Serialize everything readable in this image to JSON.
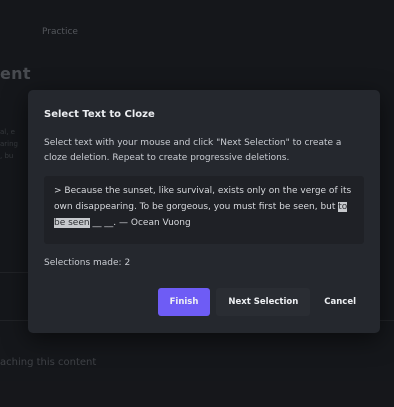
{
  "background": {
    "breadcrumb": "Practice",
    "title_fragment": "ent",
    "snippet_lines": [
      "al, e",
      "aring",
      ", bu"
    ],
    "footer_text": "aching this content"
  },
  "modal": {
    "title": "Select Text to Cloze",
    "description": "Select text with your mouse and click \"Next Selection\" to create a cloze deletion. Repeat to create progressive deletions.",
    "quote": {
      "before": "> Because the sunset, like survival, exists only on the verge of its own disappearing. To be gorgeous, you must first be seen, but ",
      "highlighted": "to be seen",
      "after": " __ __. — Ocean Vuong"
    },
    "selections_text": "Selections made: 2",
    "buttons": {
      "finish": "Finish",
      "next": "Next Selection",
      "cancel": "Cancel"
    }
  },
  "colors": {
    "accent": "#6e5cf5",
    "modal_bg": "#25282e",
    "page_bg": "#1c1e22"
  }
}
